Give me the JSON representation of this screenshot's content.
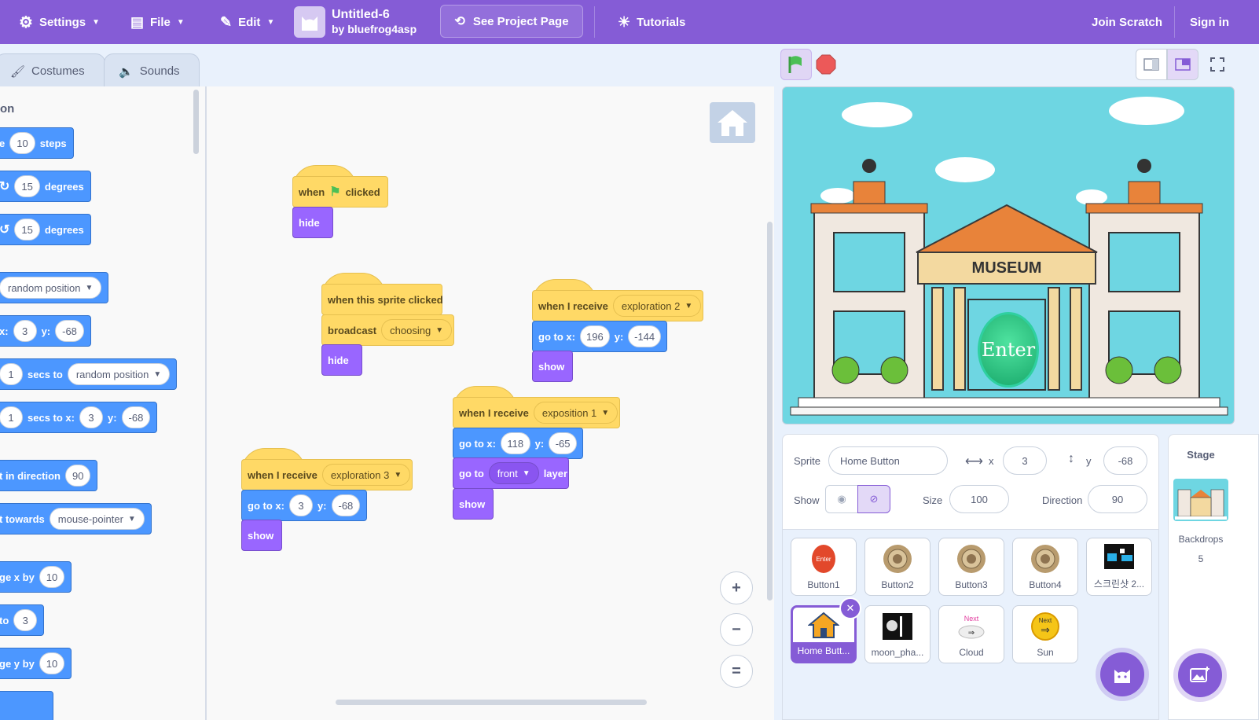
{
  "menu": {
    "settings": "Settings",
    "file": "File",
    "edit": "Edit",
    "project_title": "Untitled-6",
    "project_author": "by bluefrog4asp",
    "see_project": "See Project Page",
    "tutorials": "Tutorials",
    "join": "Join Scratch",
    "signin": "Sign in"
  },
  "tabs": {
    "costumes": "Costumes",
    "sounds": "Sounds"
  },
  "palette": {
    "category": "on",
    "blocks": [
      {
        "pre": "e",
        "v1": "10",
        "post": "steps"
      },
      {
        "v1": "15",
        "post": "degrees"
      },
      {
        "v1": "15",
        "post": "degrees"
      },
      {
        "pre": "",
        "dd": "random position"
      },
      {
        "pre": "x:",
        "v1": "3",
        "mid": "y:",
        "v2": "-68"
      },
      {
        "v1": "1",
        "mid": "secs to",
        "dd": "random position"
      },
      {
        "v1": "1",
        "mid": "secs to x:",
        "v2": "3",
        "mid2": "y:",
        "v3": "-68"
      },
      {
        "pre": "t in direction",
        "v1": "90"
      },
      {
        "pre": "t towards",
        "dd": "mouse-pointer"
      },
      {
        "pre": "ge x by",
        "v1": "10"
      },
      {
        "pre": "to",
        "v1": "3"
      },
      {
        "pre": "ge y by",
        "v1": "10"
      }
    ]
  },
  "scripts": {
    "s1": {
      "when": "when",
      "clicked": "clicked",
      "hide": "hide"
    },
    "s2": {
      "hat": "when this sprite clicked",
      "broadcast": "broadcast",
      "msg": "choosing",
      "hide": "hide"
    },
    "s3": {
      "hat": "when I receive",
      "msg": "exploration 2",
      "goto": "go to x:",
      "x": "196",
      "y_lbl": "y:",
      "y": "-144",
      "show": "show"
    },
    "s4": {
      "hat": "when I receive",
      "msg": "exposition 1",
      "goto": "go to x:",
      "x": "118",
      "y_lbl": "y:",
      "y": "-65",
      "go_to": "go to",
      "layer_dd": "front",
      "layer": "layer",
      "show": "show"
    },
    "s5": {
      "hat": "when I receive",
      "msg": "exploration 3",
      "goto": "go to x:",
      "x": "3",
      "y_lbl": "y:",
      "y": "-68",
      "show": "show"
    }
  },
  "zoom": {
    "in": "+",
    "out": "−",
    "reset": "="
  },
  "stage": {
    "sign": "MUSEUM",
    "enter": "Enter"
  },
  "sprite_info": {
    "sprite_label": "Sprite",
    "sprite_name": "Home Button",
    "x_label": "x",
    "x": "3",
    "y_label": "y",
    "y": "-68",
    "show_label": "Show",
    "size_label": "Size",
    "size": "100",
    "direction_label": "Direction",
    "direction": "90"
  },
  "sprites": [
    "Button1",
    "Button2",
    "Button3",
    "Button4",
    "스크린샷 2...",
    "Home Butt...",
    "moon_pha...",
    "Cloud",
    "Sun"
  ],
  "stage_panel": {
    "title": "Stage",
    "backdrops_label": "Backdrops",
    "backdrops_count": "5"
  },
  "colors": {
    "accent": "#855cd6",
    "motion": "#4c97ff",
    "events": "#ffd966",
    "looks": "#9966ff"
  }
}
